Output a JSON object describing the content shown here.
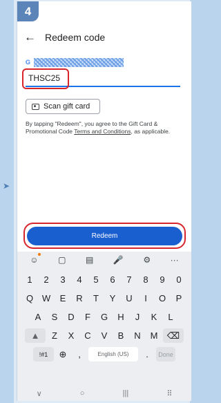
{
  "step": {
    "number": "4"
  },
  "appbar": {
    "title": "Redeem code"
  },
  "account": {
    "provider_icon": "G"
  },
  "code_field": {
    "value": "THSC25"
  },
  "scan_button": {
    "label": "Scan gift card"
  },
  "terms": {
    "prefix": "By tapping \"Redeem\", you agree to the Gift Card & Promotional Code ",
    "link": "Terms and Conditions",
    "suffix": ", as applicable."
  },
  "redeem_button": {
    "label": "Redeem"
  },
  "keyboard": {
    "toolbar": [
      "☺",
      "▢",
      "▤",
      "🎤",
      "⚙",
      "···"
    ],
    "row_numbers": [
      "1",
      "2",
      "3",
      "4",
      "5",
      "6",
      "7",
      "8",
      "9",
      "0"
    ],
    "row_q": [
      "Q",
      "W",
      "E",
      "R",
      "T",
      "Y",
      "U",
      "I",
      "O",
      "P"
    ],
    "row_a": [
      "A",
      "S",
      "D",
      "F",
      "G",
      "H",
      "J",
      "K",
      "L"
    ],
    "row_z": [
      "Z",
      "X",
      "C",
      "V",
      "B",
      "N",
      "M"
    ],
    "symbols": "!#1",
    "globe": "⊕",
    "comma": ",",
    "space": "English (US)",
    "period": ".",
    "done": "Done",
    "backspace": "⌫",
    "shift": "▲"
  },
  "nav": {
    "back": "∨",
    "home": "○",
    "recents": "|||",
    "extra": "⠿"
  },
  "colors": {
    "accent": "#1a5fd0",
    "highlight": "#d8252c",
    "badge": "#5b84b8"
  }
}
